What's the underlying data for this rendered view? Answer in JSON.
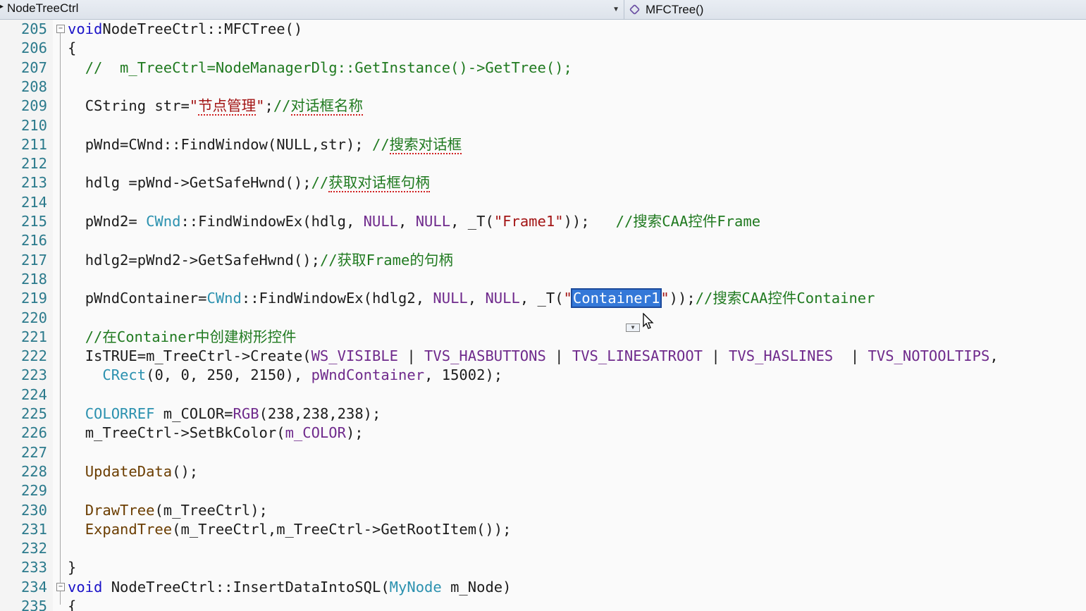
{
  "navbar": {
    "scope": "NodeTreeCtrl",
    "member": "MFCTree()"
  },
  "lines": [
    {
      "n": "205",
      "fold": true,
      "indent": 0,
      "parts": [
        [
          "kw",
          "void"
        ],
        [
          "",
          "NodeTreeCtrl::MFCTree()"
        ]
      ]
    },
    {
      "n": "206",
      "indent": 0,
      "parts": [
        [
          "",
          "{"
        ]
      ]
    },
    {
      "n": "207",
      "indent": 2,
      "parts": [
        [
          "cm",
          "//  m_TreeCtrl=NodeManagerDlg::GetInstance()->GetTree();"
        ]
      ]
    },
    {
      "n": "208",
      "indent": 0,
      "parts": []
    },
    {
      "n": "209",
      "indent": 2,
      "parts": [
        [
          "",
          "CString str="
        ],
        [
          "str",
          "\""
        ],
        [
          "str sq",
          "节点管理"
        ],
        [
          "str",
          "\""
        ],
        [
          "",
          ";"
        ],
        [
          "cm",
          "//"
        ],
        [
          "cm sq",
          "对话框名称"
        ]
      ]
    },
    {
      "n": "210",
      "indent": 0,
      "parts": []
    },
    {
      "n": "211",
      "indent": 2,
      "parts": [
        [
          "",
          "pWnd=CWnd::FindWindow(NULL,str); "
        ],
        [
          "cm",
          "//"
        ],
        [
          "cm sq",
          "搜索对话框"
        ]
      ]
    },
    {
      "n": "212",
      "indent": 0,
      "parts": []
    },
    {
      "n": "213",
      "indent": 2,
      "parts": [
        [
          "",
          "hdlg =pWnd->GetSafeHwnd();"
        ],
        [
          "cm",
          "//"
        ],
        [
          "cm sq",
          "获取对话框句柄"
        ]
      ]
    },
    {
      "n": "214",
      "indent": 0,
      "parts": []
    },
    {
      "n": "215",
      "indent": 2,
      "parts": [
        [
          "",
          "pWnd2= "
        ],
        [
          "ty",
          "CWnd"
        ],
        [
          "",
          "::FindWindowEx(hdlg, "
        ],
        [
          "mac",
          "NULL"
        ],
        [
          "",
          ", "
        ],
        [
          "mac",
          "NULL"
        ],
        [
          "",
          ", _T("
        ],
        [
          "str",
          "\"Frame1\""
        ],
        [
          "",
          "));   "
        ],
        [
          "cm",
          "//搜索CAA控件Frame"
        ]
      ]
    },
    {
      "n": "216",
      "indent": 0,
      "parts": []
    },
    {
      "n": "217",
      "indent": 2,
      "parts": [
        [
          "",
          "hdlg2=pWnd2->GetSafeHwnd();"
        ],
        [
          "cm",
          "//获取Frame的句柄"
        ]
      ]
    },
    {
      "n": "218",
      "indent": 0,
      "parts": []
    },
    {
      "n": "219",
      "indent": 2,
      "parts": [
        [
          "",
          "pWndContainer="
        ],
        [
          "ty",
          "CWnd"
        ],
        [
          "",
          "::FindWindowEx(hdlg2, "
        ],
        [
          "mac",
          "NULL"
        ],
        [
          "",
          ", "
        ],
        [
          "mac",
          "NULL"
        ],
        [
          "",
          ", _T("
        ],
        [
          "str",
          "\""
        ],
        [
          "sel",
          "Container1"
        ],
        [
          "str",
          "\""
        ],
        [
          "",
          "));"
        ],
        [
          "cm",
          "//搜索CAA控件Container"
        ]
      ]
    },
    {
      "n": "220",
      "indent": 0,
      "parts": []
    },
    {
      "n": "221",
      "indent": 2,
      "parts": [
        [
          "cm",
          "//在Container中创建树形控件"
        ]
      ]
    },
    {
      "n": "222",
      "indent": 2,
      "parts": [
        [
          "",
          "IsTRUE=m_TreeCtrl->Create("
        ],
        [
          "mac",
          "WS_VISIBLE"
        ],
        [
          "",
          " | "
        ],
        [
          "mac",
          "TVS_HASBUTTONS"
        ],
        [
          "",
          " | "
        ],
        [
          "mac",
          "TVS_LINESATROOT"
        ],
        [
          "",
          " | "
        ],
        [
          "mac",
          "TVS_HASLINES"
        ],
        [
          "",
          "  | "
        ],
        [
          "mac",
          "TVS_NOTOOLTIPS"
        ],
        [
          "",
          ","
        ]
      ]
    },
    {
      "n": "223",
      "indent": 4,
      "parts": [
        [
          "ty",
          "CRect"
        ],
        [
          "",
          "(0, 0, 250, 2150), "
        ],
        [
          "mac",
          "pWndContainer"
        ],
        [
          "",
          ", 15002);"
        ]
      ]
    },
    {
      "n": "224",
      "indent": 0,
      "parts": []
    },
    {
      "n": "225",
      "indent": 2,
      "parts": [
        [
          "ty",
          "COLORREF"
        ],
        [
          "",
          " m_COLOR="
        ],
        [
          "mac",
          "RGB"
        ],
        [
          "",
          "(238,238,238);"
        ]
      ]
    },
    {
      "n": "226",
      "indent": 2,
      "parts": [
        [
          "",
          "m_TreeCtrl->SetBkColor("
        ],
        [
          "mac",
          "m_COLOR"
        ],
        [
          "",
          ");"
        ]
      ]
    },
    {
      "n": "227",
      "indent": 0,
      "parts": []
    },
    {
      "n": "228",
      "indent": 2,
      "parts": [
        [
          "fn",
          "UpdateData"
        ],
        [
          "",
          "();"
        ]
      ]
    },
    {
      "n": "229",
      "indent": 0,
      "parts": []
    },
    {
      "n": "230",
      "indent": 2,
      "parts": [
        [
          "fn",
          "DrawTree"
        ],
        [
          "",
          "(m_TreeCtrl);"
        ]
      ]
    },
    {
      "n": "231",
      "indent": 2,
      "parts": [
        [
          "fn",
          "ExpandTree"
        ],
        [
          "",
          "(m_TreeCtrl,m_TreeCtrl->GetRootItem());"
        ]
      ]
    },
    {
      "n": "232",
      "indent": 0,
      "parts": []
    },
    {
      "n": "233",
      "indent": 0,
      "parts": [
        [
          "",
          "}"
        ]
      ]
    },
    {
      "n": "234",
      "fold": true,
      "indent": 0,
      "parts": [
        [
          "kw",
          "void"
        ],
        [
          "",
          " NodeTreeCtrl::InsertDataIntoSQL("
        ],
        [
          "ty",
          "MyNode"
        ],
        [
          "",
          " m_Node)"
        ]
      ]
    },
    {
      "n": "235",
      "indent": 0,
      "parts": [
        [
          "",
          "{"
        ]
      ]
    }
  ]
}
